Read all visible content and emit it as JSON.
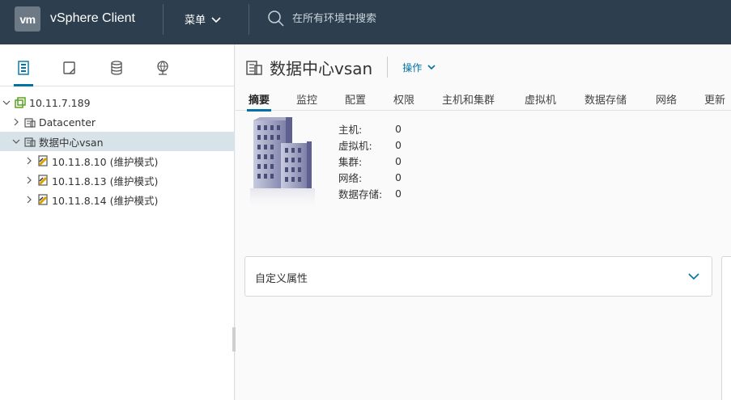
{
  "topbar": {
    "logo": "vm",
    "app_title": "vSphere Client",
    "menu_label": "菜单",
    "search_placeholder": "在所有环境中搜索"
  },
  "left_tabs": [
    {
      "name": "hosts-clusters-icon",
      "active": true
    },
    {
      "name": "vms-templates-icon",
      "active": false
    },
    {
      "name": "storage-icon",
      "active": false
    },
    {
      "name": "networking-icon",
      "active": false
    }
  ],
  "tree": {
    "items": [
      {
        "label": "10.11.7.189",
        "level": 0,
        "expanded": true,
        "type": "vcenter"
      },
      {
        "label": "Datacenter",
        "level": 1,
        "expanded": false,
        "type": "datacenter"
      },
      {
        "label": "数据中心vsan",
        "level": 1,
        "expanded": true,
        "type": "datacenter",
        "selected": true
      },
      {
        "label": "10.11.8.10 (维护模式)",
        "level": 2,
        "expanded": false,
        "type": "host-maintenance"
      },
      {
        "label": "10.11.8.13 (维护模式)",
        "level": 2,
        "expanded": false,
        "type": "host-maintenance"
      },
      {
        "label": "10.11.8.14 (维护模式)",
        "level": 2,
        "expanded": false,
        "type": "host-maintenance"
      }
    ]
  },
  "main": {
    "title": "数据中心vsan",
    "actions_label": "操作",
    "tabs": [
      {
        "label": "摘要",
        "active": true
      },
      {
        "label": "监控"
      },
      {
        "label": "配置"
      },
      {
        "label": "权限"
      },
      {
        "label": "主机和集群"
      },
      {
        "label": "虚拟机"
      },
      {
        "label": "数据存储"
      },
      {
        "label": "网络"
      },
      {
        "label": "更新"
      }
    ],
    "summary": [
      {
        "label": "主机:",
        "value": "0"
      },
      {
        "label": "虚拟机:",
        "value": "0"
      },
      {
        "label": "集群:",
        "value": "0"
      },
      {
        "label": "网络:",
        "value": "0"
      },
      {
        "label": "数据存储:",
        "value": "0"
      }
    ],
    "custom_attributes_title": "自定义属性"
  },
  "colors": {
    "topbar": "#2d3f4e",
    "accent": "#0072a3",
    "selected_row": "#d8e3e9"
  }
}
